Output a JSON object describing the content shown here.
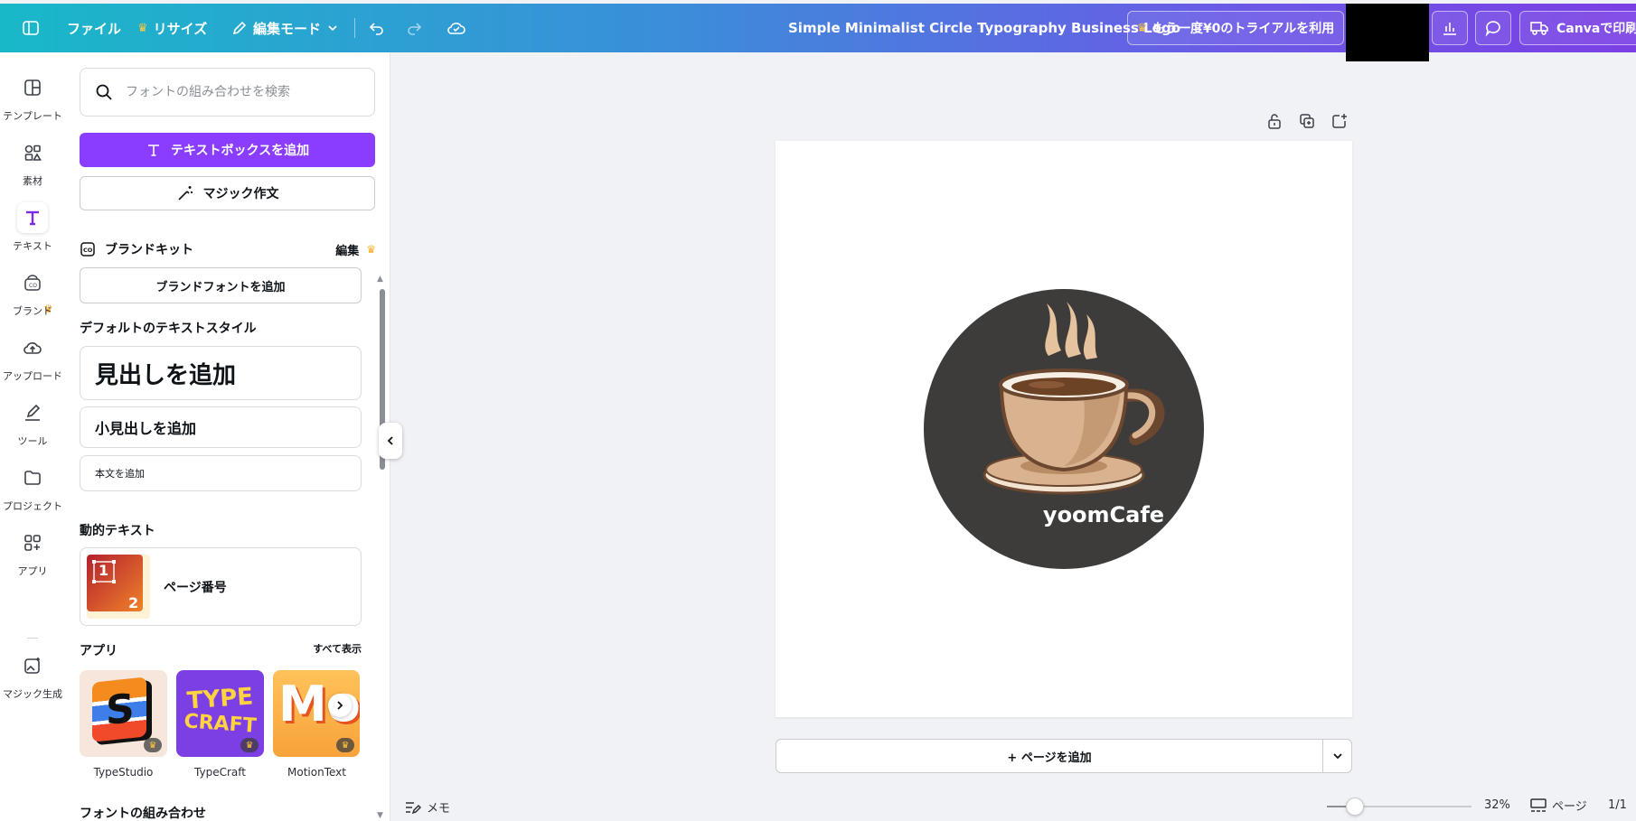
{
  "topbar": {
    "file": "ファイル",
    "resize": "リサイズ",
    "edit_mode": "編集モード",
    "doc_title": "Simple Minimalist Circle Typography Business Logo",
    "trial": "もう一度¥0のトライアルを利用",
    "print": "Canvaで印刷"
  },
  "rail": {
    "items": [
      {
        "label": "テンプレート"
      },
      {
        "label": "素材"
      },
      {
        "label": "テキスト"
      },
      {
        "label": "ブランド"
      },
      {
        "label": "アップロード"
      },
      {
        "label": "ツール"
      },
      {
        "label": "プロジェクト"
      },
      {
        "label": "アプリ"
      },
      {
        "label": "マジック生成"
      }
    ]
  },
  "panel": {
    "search_placeholder": "フォントの組み合わせを検索",
    "add_textbox": "テキストボックスを追加",
    "magic_write": "マジック作文",
    "brand_kit": "ブランドキット",
    "brand_edit": "編集",
    "add_brand_font": "ブランドフォントを追加",
    "default_styles_title": "デフォルトのテキストスタイル",
    "heading": "見出しを追加",
    "subheading": "小見出しを追加",
    "body": "本文を追加",
    "dynamic_title": "動的テキスト",
    "page_number": "ページ番号",
    "page_thumb_1": "1",
    "page_thumb_2": "2",
    "apps_title": "アプリ",
    "see_all": "すべて表示",
    "apps": [
      {
        "name": "TypeStudio",
        "thumb_text": "S"
      },
      {
        "name": "TypeCraft",
        "thumb_line1": "TYPE",
        "thumb_line2": "CRAFT"
      },
      {
        "name": "MotionText",
        "thumb_text": "Mo"
      }
    ],
    "font_combos": "フォントの組み合わせ"
  },
  "canvas": {
    "logo_text": "yoomCafe",
    "add_page": "+ ページを追加"
  },
  "bottombar": {
    "memo": "メモ",
    "zoom_percent": 32,
    "zoom_label": "32%",
    "pages": "ページ",
    "page_count": "1/1"
  },
  "colors": {
    "accent": "#8b3dff",
    "logo_circle": "#3e3c3a",
    "cup": "#d9b38f"
  }
}
